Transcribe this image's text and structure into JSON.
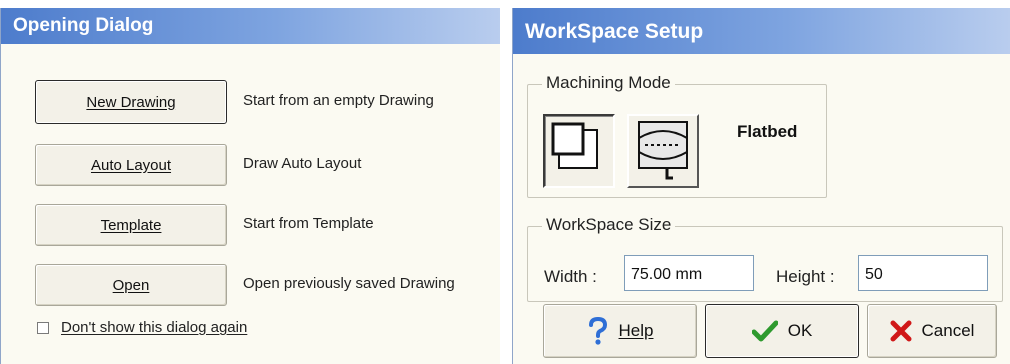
{
  "opening_dialog": {
    "title": "Opening Dialog",
    "buttons": [
      {
        "label": "New Drawing",
        "description": "Start from an empty Drawing"
      },
      {
        "label": "Auto Layout",
        "description": "Draw Auto Layout"
      },
      {
        "label": "Template",
        "description": "Start from Template"
      },
      {
        "label": "Open",
        "description": "Open previously saved Drawing"
      }
    ],
    "dont_show_label": "Don't show this dialog again",
    "dont_show_checked": false
  },
  "workspace_dialog": {
    "title": "WorkSpace Setup",
    "machining_mode": {
      "group_label": "Machining Mode",
      "selected_mode": "Flatbed",
      "icons": [
        "flatbed-mode-icon",
        "rotary-mode-icon"
      ]
    },
    "workspace_size": {
      "group_label": "WorkSpace Size",
      "width_label": "Width :",
      "width_value": "75.00 mm",
      "height_label": "Height :",
      "height_value": "50"
    },
    "footer": {
      "help_label": "Help",
      "ok_label": "OK",
      "cancel_label": "Cancel"
    }
  },
  "colors": {
    "title_gradient_start": "#4d7ccc",
    "dialog_background": "#fbfaf2",
    "help_icon": "#2f6fd6",
    "ok_icon": "#2e9a2e",
    "cancel_icon": "#d01818"
  }
}
